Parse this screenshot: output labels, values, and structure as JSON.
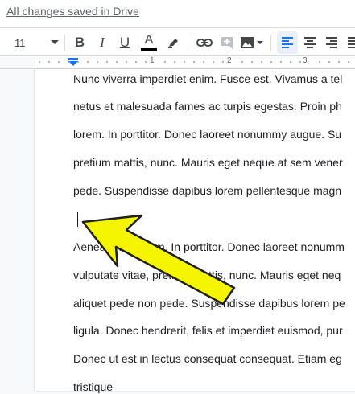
{
  "status": {
    "saved_text": "All changes saved in Drive"
  },
  "toolbar": {
    "font_size": "11",
    "bold": "B",
    "italic": "I",
    "underline": "U",
    "text_color_label": "A",
    "text_color": "#000000"
  },
  "ruler": {
    "labels": [
      "1",
      "2",
      "3"
    ]
  },
  "document": {
    "lines": [
      "Nunc viverra imperdiet enim. Fusce est. Vivamus a tel",
      "netus et malesuada fames ac turpis egestas. Proin ph",
      "lorem. In porttitor. Donec laoreet nonummy augue. Su",
      "pretium mattis, nunc. Mauris eget neque at sem vener",
      "pede. Suspendisse dapibus lorem pellentesque magn",
      "Aenean nec lorem. In porttitor. Donec laoreet nonumm",
      "vulputate vitae, pretium mattis, nunc. Mauris eget neq",
      "aliquet pede non pede. Suspendisse dapibus lorem pe",
      "ligula. Donec hendrerit, felis et imperdiet euismod, pur",
      "Donec ut est in lectus consequat consequat. Etiam eg",
      "tristique"
    ]
  },
  "annotation": {
    "arrow_color": "#f5f500"
  }
}
